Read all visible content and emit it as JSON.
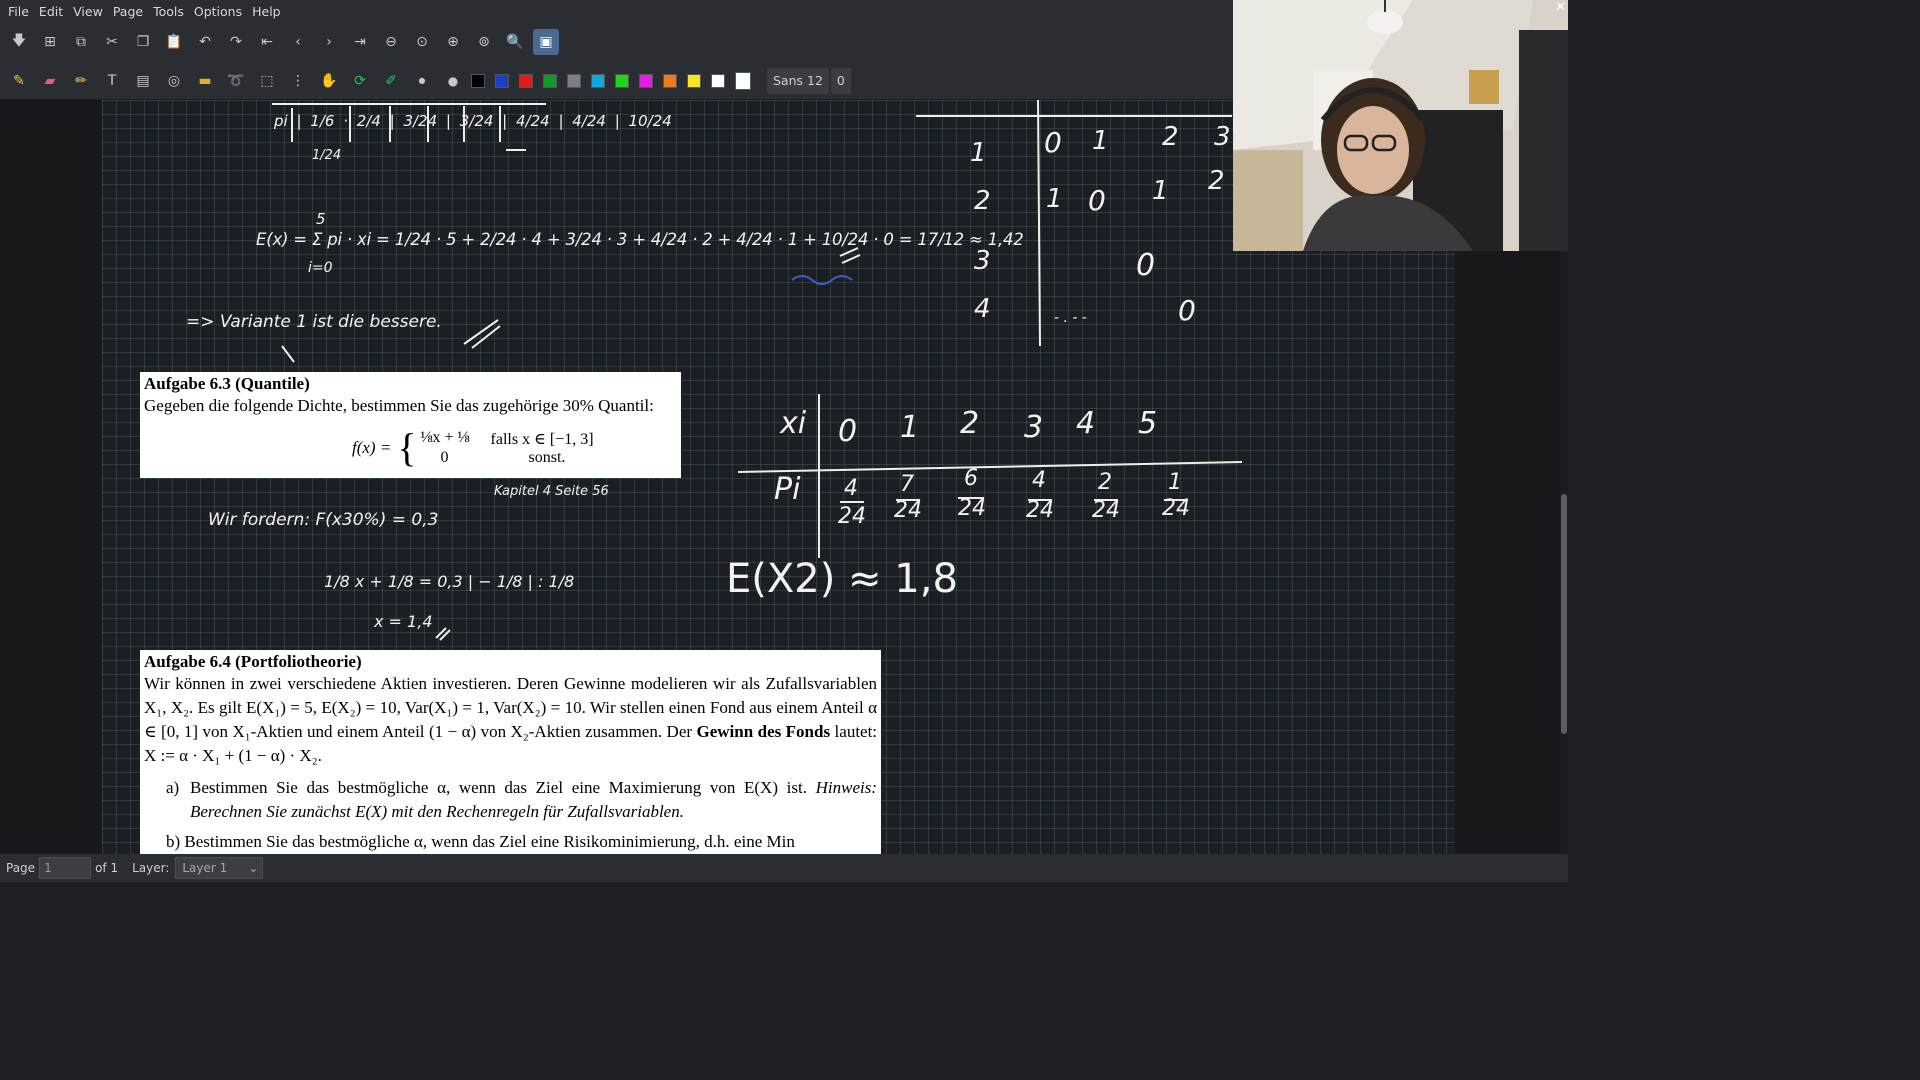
{
  "menu": [
    "File",
    "Edit",
    "View",
    "Page",
    "Tools",
    "Options",
    "Help"
  ],
  "toolbar": {
    "font_name": "Sans 12",
    "font_size": "0",
    "colors": [
      "#000000",
      "#1e3ec8",
      "#e21b1b",
      "#109a2a",
      "#7f7f7f",
      "#10a7e0",
      "#1fd61f",
      "#e51ee5",
      "#f07a1a",
      "#f5e61f",
      "#ffffff"
    ]
  },
  "tasks": {
    "t63": {
      "title": "Aufgabe 6.3 (Quantile)",
      "text": "Gegeben die folgende Dichte, bestimmen Sie das zugehörige 30% Quantil:",
      "f_label": "f(x) =",
      "case1_expr": "⅛x + ⅛",
      "case1_cond": "falls x ∈ [−1, 3]",
      "case2_expr": "0",
      "case2_cond": "sonst."
    },
    "t64": {
      "title": "Aufgabe 6.4 (Portfoliotheorie)",
      "p1": "Wir können in zwei verschiedene Aktien investieren. Deren Gewinne modelieren wir als Zufallsvariablen X₁, X₂. Es gilt E(X₁) = 5, E(X₂) = 10, Var(X₁) = 1, Var(X₂) = 10. Wir stellen einen Fond aus einem Anteil α ∈ [0, 1] von X₁-Aktien und einem Anteil (1 − α) von X₂-Aktien zusammen. Der",
      "bold": "Gewinn des Fonds",
      "p1_end": "lautet: X := α · X₁ + (1 − α) · X₂.",
      "a_label": "a)",
      "a_text": "Bestimmen Sie das bestmögliche α, wenn das Ziel eine Maximierung von E(X) ist.",
      "a_hint": "Hinweis: Berechnen Sie zunächst E(X) mit den Rechenregeln für Zufallsvariablen.",
      "b_text": "b) Bestimmen Sie das bestmögliche α, wenn das Ziel eine Risikominimierung, d.h. eine Min"
    }
  },
  "handwriting": {
    "pi_row": "pi | 1/6 · 2/4 | 3/24 | 3/24 | 4/24 | 4/24 | 10/24",
    "pi_extra": "1/24",
    "expectation": "E(x) = Σ pi · xi = 1/24 · 5 + 2/24 · 4 + 3/24 · 3 + 4/24 · 2 + 4/24 · 1 + 10/24 · 0 = 17/12 ≈ 1,42",
    "sum_top": "5",
    "sum_bottom": "i=0",
    "conclusion": "=> Variante 1 ist die bessere.",
    "kapitel": "Kapitel 4 Seite 56",
    "fordern": "Wir fordern: F(x30%) = 0,3",
    "equation": "1/8 x + 1/8 = 0,3   | − 1/8 | : 1/8",
    "result": "x = 1,4",
    "table_right_rows": [
      "1",
      "2",
      "3",
      "4"
    ],
    "table_right_r1": [
      "0",
      "1",
      "2",
      "3"
    ],
    "table_right_r2": [
      "1",
      "0",
      "1",
      "2"
    ],
    "table_right_r3": [
      "0"
    ],
    "table_right_r4": [
      "- . - -",
      "0"
    ],
    "xi_label": "xi",
    "xi_values": [
      "0",
      "1",
      "2",
      "3",
      "4",
      "5"
    ],
    "pi_label": "Pi",
    "pi_num": [
      "4",
      "7",
      "6",
      "4",
      "2",
      "1"
    ],
    "pi_den": [
      "24",
      "24",
      "24",
      "24",
      "24",
      "24"
    ],
    "ex2": "E(X2) ≈ 1,8"
  },
  "status": {
    "page_label": "Page",
    "page_value": "1",
    "of_label": "of 1",
    "layer_label": "Layer:",
    "layer_value": "Layer 1"
  }
}
